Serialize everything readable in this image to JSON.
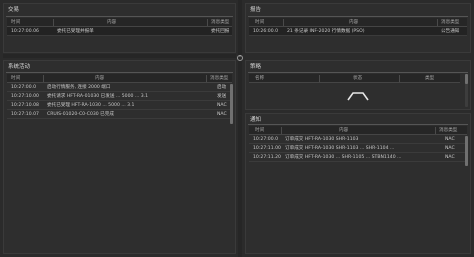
{
  "colors": {
    "background": "#2b2b2b",
    "panel": "#2e2e2e",
    "header": "#262626",
    "text": "#c8c8c8"
  },
  "panels": {
    "top_left": {
      "title": "交易",
      "columns": [
        "时间",
        "内容",
        "消息类型"
      ],
      "rows": [
        [
          "10:27:00.06",
          "委托已受理并报单",
          "委托回报"
        ]
      ]
    },
    "bottom_left": {
      "title": "系统活动",
      "columns": [
        "时间",
        "内容",
        "消息类型"
      ],
      "rows": [
        [
          "10:27:00.0",
          "启动行情服务, 连接 2000 端口",
          "启动"
        ],
        [
          "10:27:10.00",
          "委托请求 HFT-RA-01030 已发送 ... 5000 ... 3.1",
          "发送"
        ],
        [
          "10:27:10.08",
          "委托已受理 HFT-RA-1030 ... 5000 ... 3.1",
          "NAC"
        ],
        [
          "10:27:10.07",
          "CRUIS-01020-C0-C030 已完成",
          "NAC"
        ]
      ]
    },
    "top_right": {
      "title": "报告",
      "columns": [
        "时间",
        "内容",
        "消息类型"
      ],
      "rows": [
        [
          "10:26:00.0",
          "21 条记录 INF-2020 行情数据 (PSO)",
          "公告通知"
        ]
      ]
    },
    "middle_right": {
      "title": "策略",
      "columns": [
        "名称",
        "状态",
        "类型"
      ],
      "rows": []
    },
    "bottom_right": {
      "title": "通知",
      "columns": [
        "时间",
        "内容",
        "消息类型"
      ],
      "rows": [
        [
          "10:27:00.0",
          "订单成交 HFT-RA-1030 SHR-1103",
          "NAC"
        ],
        [
          "10:27:11.00",
          "订单成交 HFT-RA-1030 SHR-1103 ... SHR-1104 ...",
          "NAC"
        ],
        [
          "10:27:11.20",
          "订单成交 HFT-RA-1030 ... SHR-1105 ... STBN1140 ...",
          "NAC"
        ]
      ]
    }
  }
}
